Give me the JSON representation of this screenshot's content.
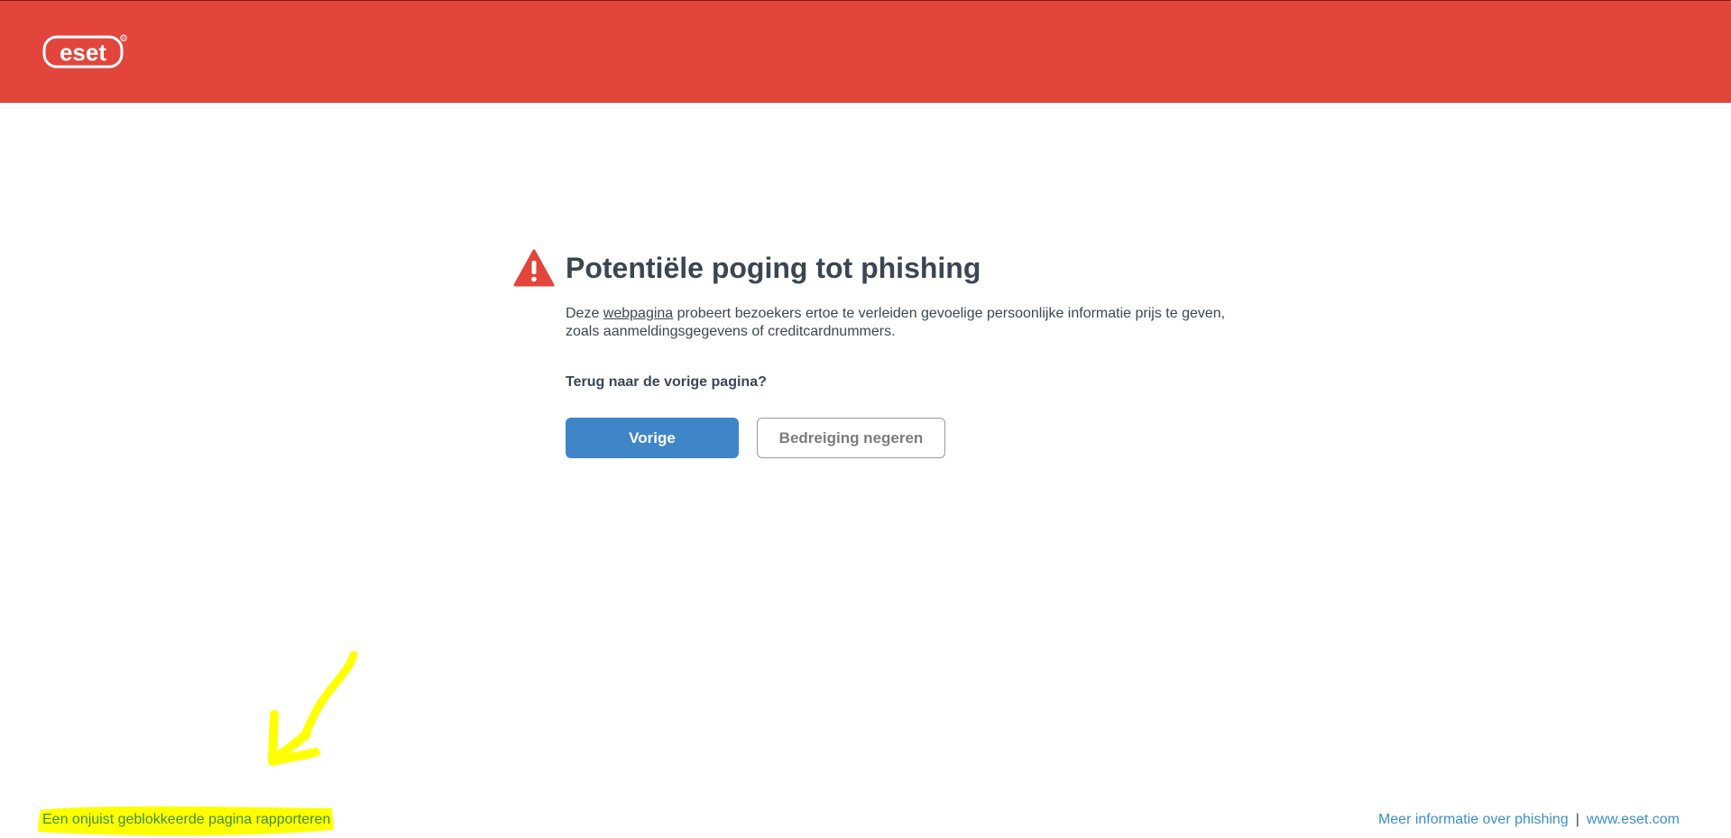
{
  "brand": {
    "logo_text": "eset",
    "header_color": "#e2453b"
  },
  "warning": {
    "icon": "warning-triangle-icon",
    "title": "Potentiële poging tot phishing",
    "desc_prefix": "Deze ",
    "desc_link": "webpagina",
    "desc_suffix": " probeert bezoekers ertoe te verleiden gevoelige persoonlijke informatie prijs te geven, zoals aanmeldingsgegevens of creditcardnummers.",
    "question": "Terug naar de vorige pagina?"
  },
  "buttons": {
    "back_label": "Vorige",
    "ignore_label": "Bedreiging negeren",
    "primary_color": "#3f86c9"
  },
  "footer": {
    "report_link": "Een onjuist geblokkeerde pagina rapporteren",
    "more_info_link": "Meer informatie over phishing",
    "separator": "|",
    "site_link": "www.eset.com"
  },
  "annotation": {
    "color": "#ffff00",
    "icon": "arrow-annotation-icon"
  }
}
